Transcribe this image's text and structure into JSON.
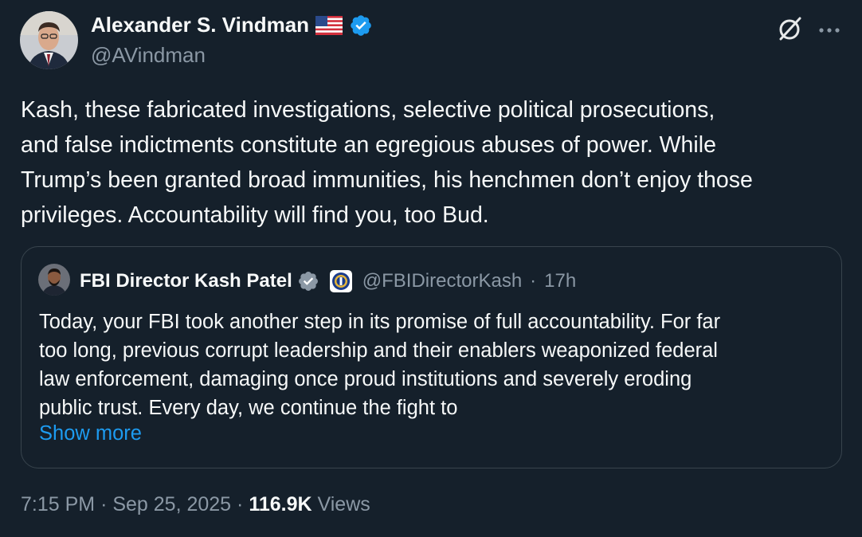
{
  "author": {
    "name": "Alexander S. Vindman",
    "handle": "@AVindman",
    "flag_icon": "us-flag-icon",
    "verified_color": "#1d9bf0"
  },
  "body": {
    "lines": [
      "Kash, these fabricated investigations, selective political prosecutions,",
      "and false indictments constitute an egregious abuses of power. While",
      "Trump’s been granted broad immunities, his henchmen don’t enjoy those",
      "privileges. Accountability will find you, too Bud."
    ]
  },
  "quote": {
    "name": "FBI Director Kash Patel",
    "handle": "@FBIDirectorKash",
    "separator": "·",
    "time": "17h",
    "verified_color": "#8b98a5",
    "lines": [
      "Today, your FBI took another step in its promise of full accountability. For far",
      "too long, previous corrupt leadership and their enablers weaponized federal",
      "law enforcement, damaging once proud institutions and severely eroding",
      "public trust. Every day, we continue the fight to"
    ],
    "show_more": "Show more"
  },
  "footer": {
    "time": "7:15 PM",
    "sep1": "·",
    "date": "Sep 25, 2025",
    "sep2": "·",
    "views_count": "116.9K",
    "views_label": "Views"
  },
  "colors": {
    "background": "#15202b",
    "text": "#f7f9f9",
    "secondary": "#8b98a5",
    "accent": "#1d9bf0",
    "border": "#38444d"
  }
}
